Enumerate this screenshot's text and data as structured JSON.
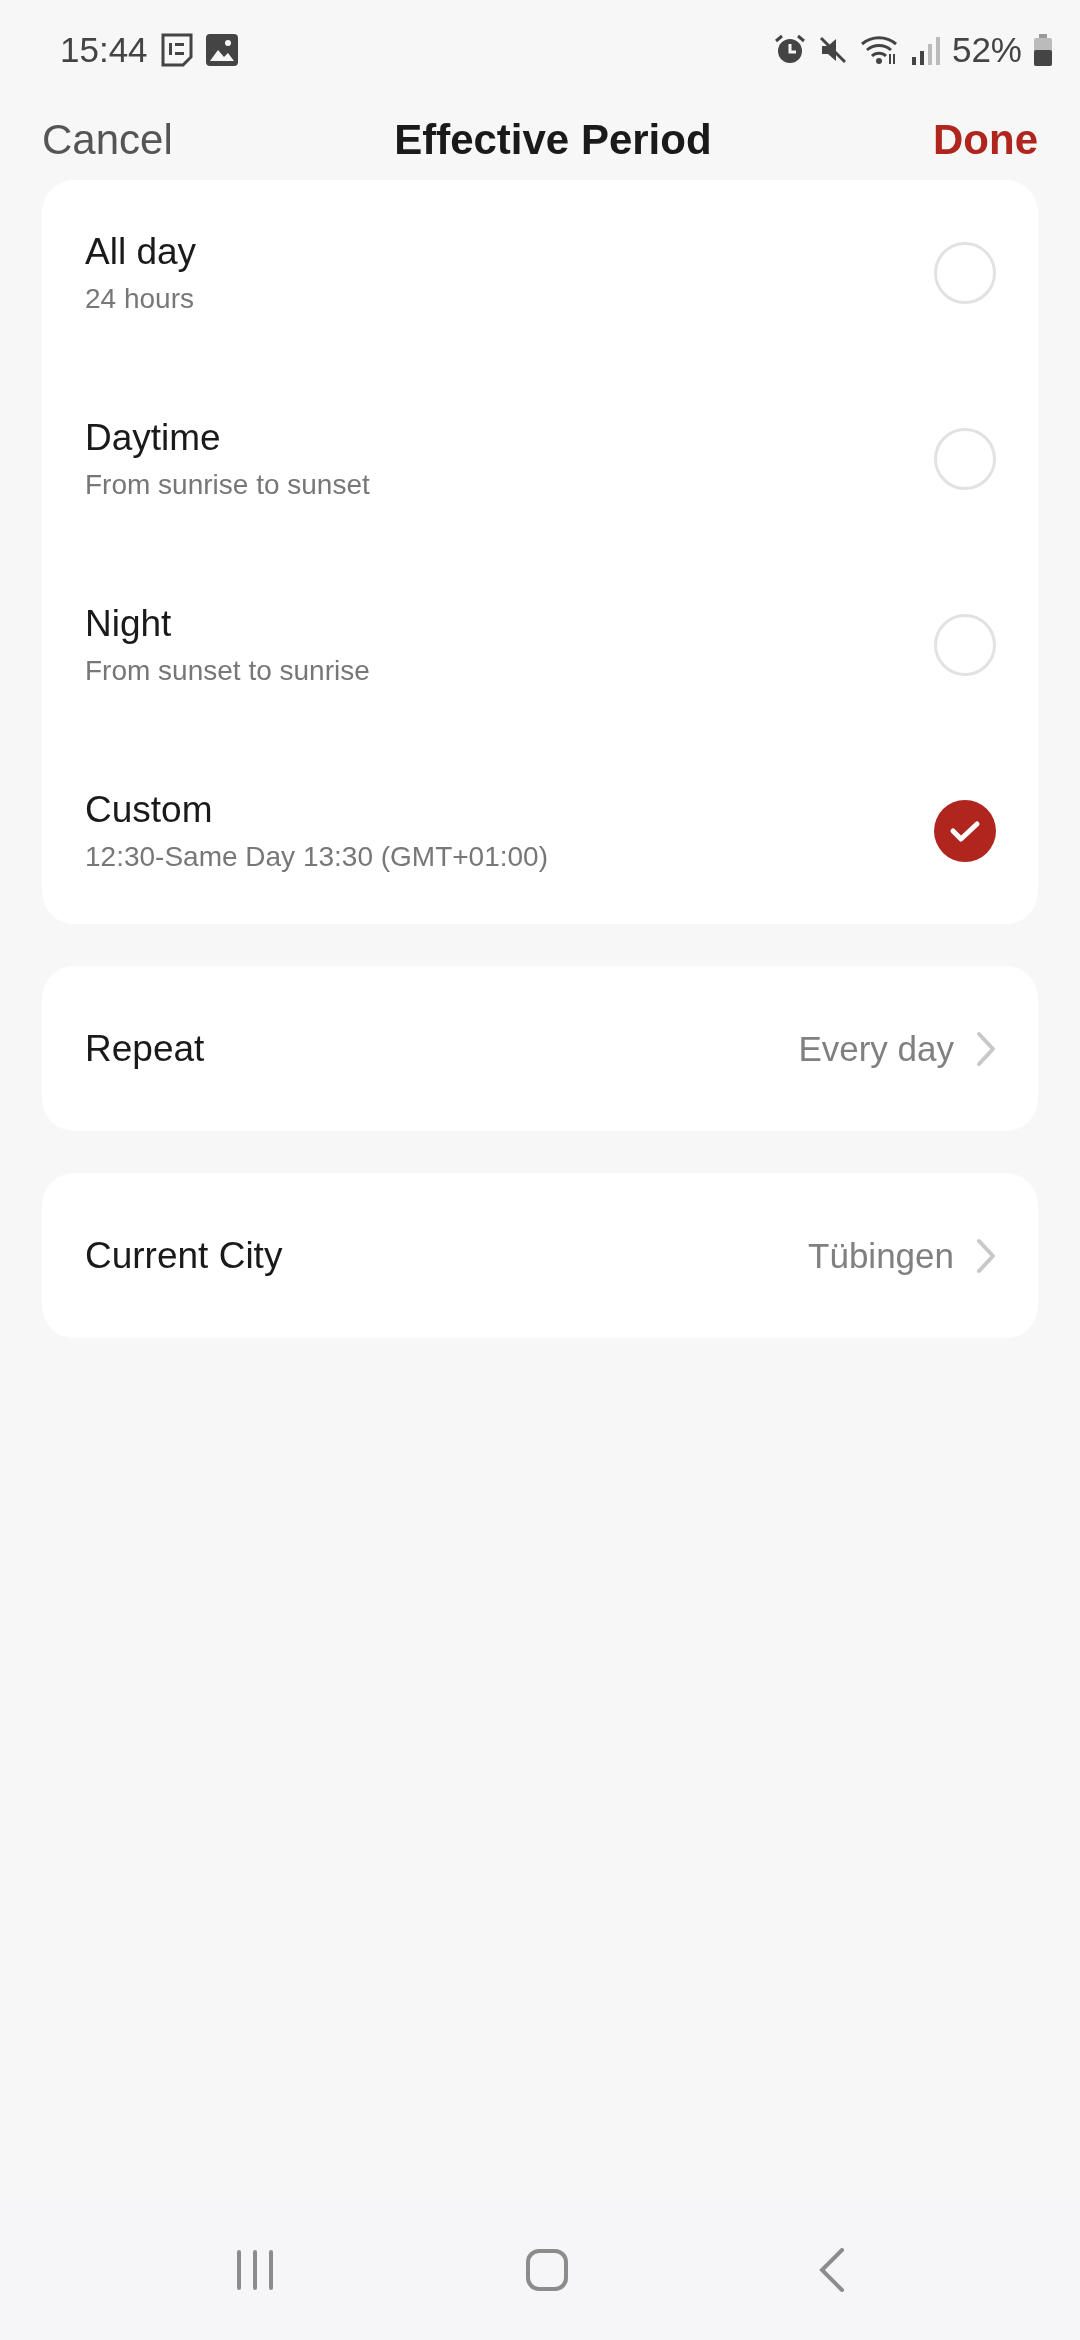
{
  "status_bar": {
    "time": "15:44",
    "battery": "52%"
  },
  "header": {
    "cancel": "Cancel",
    "title": "Effective Period",
    "done": "Done"
  },
  "periods": [
    {
      "title": "All day",
      "subtitle": "24 hours",
      "selected": false
    },
    {
      "title": "Daytime",
      "subtitle": "From sunrise to sunset",
      "selected": false
    },
    {
      "title": "Night",
      "subtitle": "From sunset to sunrise",
      "selected": false
    },
    {
      "title": "Custom",
      "subtitle": "12:30-Same Day 13:30 (GMT+01:00)",
      "selected": true
    }
  ],
  "settings": [
    {
      "label": "Repeat",
      "value": "Every day"
    },
    {
      "label": "Current City",
      "value": "Tübingen"
    }
  ]
}
